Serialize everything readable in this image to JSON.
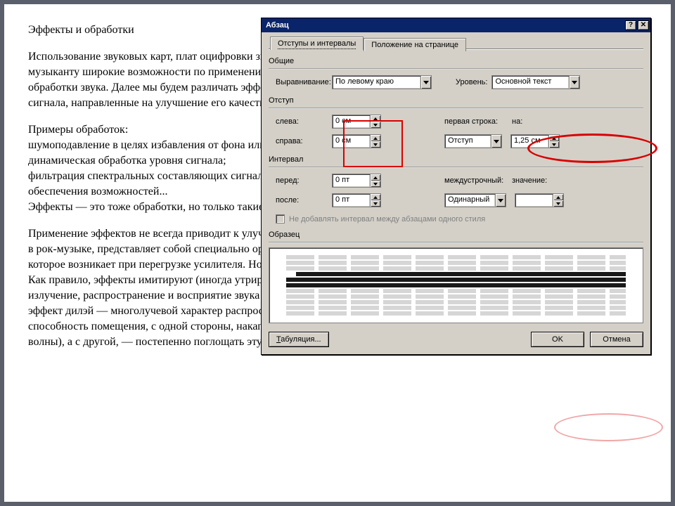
{
  "doc": {
    "title": "Эффекты и обработки",
    "p1": "Использование звуковых карт, плат оцифровки звука, программ - звуковых редакторов предоставляет компьютерному музыканту широкие возможности по применению в музыкальных композициях различных звуковых эффектов и приемов обработки звука. Далее мы будем различать эффекты и обработки. Обработки — это те преобразования исходного звукового сигнала, направленные на улучшение его качества (в некотором оговоренном смысле).",
    "p2": "Примеры обработок:\nшумоподавление в целях избавления от фона или шипения;\nдинамическая обработка уровня сигнала;\nфильтрация спектральных составляющих сигнала, частотная коррекция тембра инструмента или голоса, а также для обеспечения возможностей...\nЭффекты — это тоже обработки, но только такие, которые придают сигналу свойства, которых у него исходно не было.",
    "p3": "Применение эффектов не всегда приводит к улучшению качества звучания. Например, эффект дистошн, широко используемый в рок-музыке, представляет собой специально организованное сильнейшее искажение исходного сигнала, подобное тому, которое возникает при перегрузке усилителя. Но для некоторых музыкальных стилей такой эффект оказывается уместен.\nКак правило, эффекты имитируют (иногда утрированно передают) те реальные акустические явления, сопровождающие излучение, распространение и восприятие звука человеком. Например, эффект эхо имитирует отражение звука от преграды, эффект дилэй — многолучевой характер распространения звука в ограниченном пространстве, эффект реверберация — способность помещения, с одной стороны, накапливать энергию звуковых колебаний (многократно переотражать звуковые волны), а с другой, — постепенно поглощать эту энергию, превращая ее в тепло, нагревающее поверхности помещения."
  },
  "dialog": {
    "title": "Абзац",
    "tabs": {
      "t1": "Отступы и интервалы",
      "t2": "Положение на странице"
    },
    "groups": {
      "common": {
        "label": "Общие",
        "align_label": "Выравнивание:",
        "align_value": "По левому краю",
        "level_label": "Уровень:",
        "level_value": "Основной текст"
      },
      "indent": {
        "label": "Отступ",
        "left_label": "слева:",
        "left_value": "0 см",
        "right_label": "справа:",
        "right_value": "0 см",
        "first_label": "первая строка:",
        "first_value": "Отступ",
        "by_label": "на:",
        "by_value": "1,25 см"
      },
      "spacing": {
        "label": "Интервал",
        "before_label": "перед:",
        "before_value": "0 пт",
        "after_label": "после:",
        "after_value": "0 пт",
        "line_label": "междустрочный:",
        "line_value": "Одинарный",
        "at_label": "значение:",
        "at_value": ""
      },
      "no_space_chk": "Не добавлять интервал между абзацами одного стиля",
      "sample": {
        "label": "Образец"
      }
    },
    "buttons": {
      "tabs": "Табуляция...",
      "ok": "OK",
      "cancel": "Отмена"
    },
    "caption": {
      "help": "?",
      "close": "✕"
    }
  }
}
